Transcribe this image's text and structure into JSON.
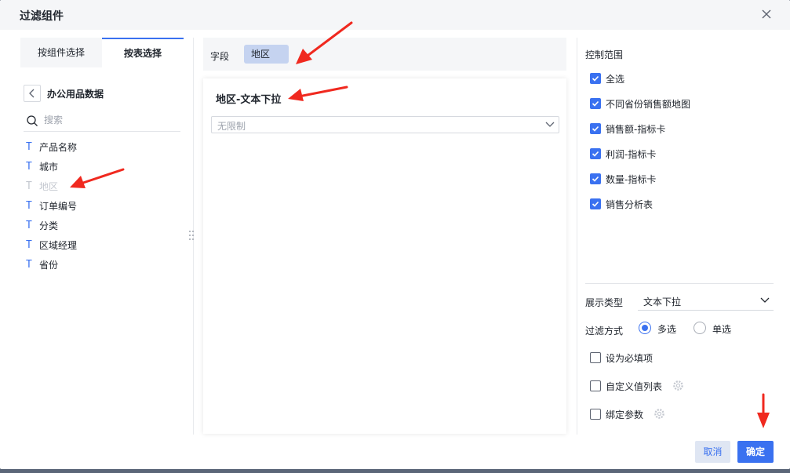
{
  "dialog": {
    "title": "过滤组件"
  },
  "left": {
    "tabs": [
      {
        "label": "按组件选择",
        "active": false
      },
      {
        "label": "按表选择",
        "active": true
      }
    ],
    "dataset_name": "办公用品数据",
    "search_placeholder": "搜索",
    "fields": [
      {
        "label": "产品名称",
        "type_icon": "T",
        "disabled": false
      },
      {
        "label": "城市",
        "type_icon": "T",
        "disabled": false
      },
      {
        "label": "地区",
        "type_icon": "T",
        "disabled": true
      },
      {
        "label": "订单编号",
        "type_icon": "T",
        "disabled": false
      },
      {
        "label": "分类",
        "type_icon": "T",
        "disabled": false
      },
      {
        "label": "区域经理",
        "type_icon": "T",
        "disabled": false
      },
      {
        "label": "省份",
        "type_icon": "T",
        "disabled": false
      }
    ]
  },
  "middle": {
    "field_label": "字段",
    "field_tag": "地区",
    "card_title": "地区-文本下拉",
    "select_placeholder": "无限制"
  },
  "right": {
    "scope_title": "控制范围",
    "scope_items": [
      {
        "label": "全选",
        "checked": true
      },
      {
        "label": "不同省份销售额地图",
        "checked": true
      },
      {
        "label": "销售额-指标卡",
        "checked": true
      },
      {
        "label": "利润-指标卡",
        "checked": true
      },
      {
        "label": "数量-指标卡",
        "checked": true
      },
      {
        "label": "销售分析表",
        "checked": true
      }
    ],
    "display_type_label": "展示类型",
    "display_type_value": "文本下拉",
    "filter_mode_label": "过滤方式",
    "filter_modes": [
      {
        "label": "多选",
        "selected": true
      },
      {
        "label": "单选",
        "selected": false
      }
    ],
    "required_label": "设为必填项",
    "custom_list_label": "自定义值列表",
    "bind_param_label": "绑定参数"
  },
  "footer": {
    "cancel": "取消",
    "ok": "确定"
  },
  "colors": {
    "accent": "#3a71f0",
    "tag_bg": "#c5d3f0",
    "annotation_arrow": "#f0291f"
  },
  "icons": [
    "close-icon",
    "chevron-left-icon",
    "search-icon",
    "text-field-icon",
    "chevron-down-icon",
    "check-icon",
    "gear-icon",
    "drag-handle-icon",
    "red-arrow-annotation"
  ]
}
